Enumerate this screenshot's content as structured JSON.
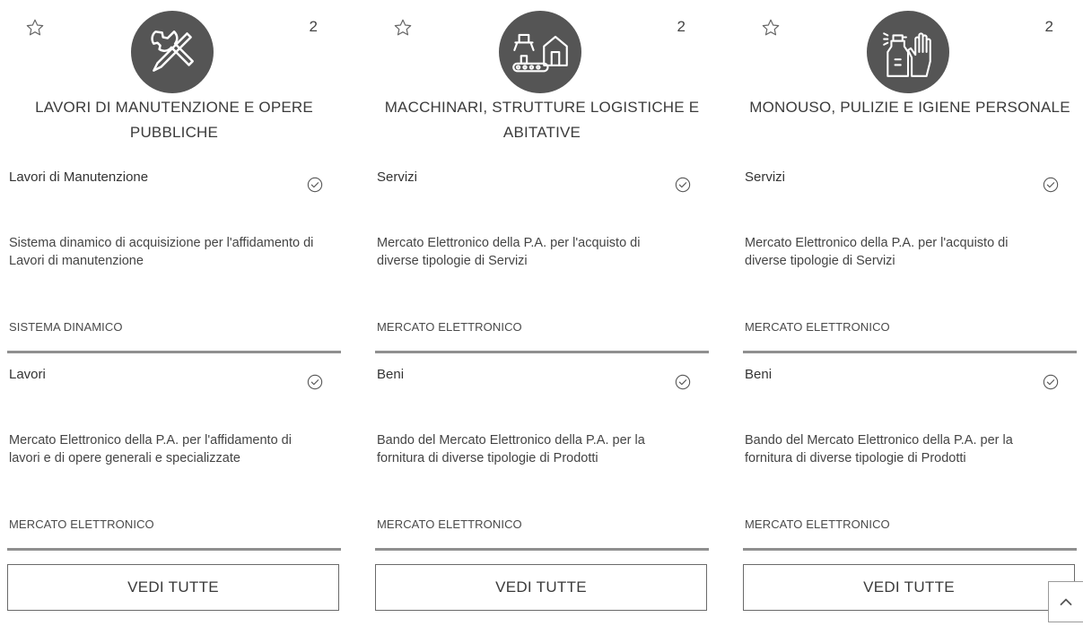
{
  "cards": [
    {
      "title": "LAVORI DI MANUTENZIONE E OPERE PUBBLICHE",
      "count": "2",
      "icon": "tools-icon",
      "items": [
        {
          "name": "Lavori di Manutenzione",
          "description": "Sistema dinamico di acquisizione per l'affidamento di Lavori di manutenzione",
          "type": "SISTEMA DINAMICO"
        },
        {
          "name": "Lavori",
          "description": "Mercato Elettronico della P.A. per l'affidamento di lavori e di opere generali e specializzate",
          "type": "MERCATO ELETTRONICO"
        }
      ],
      "button": "VEDI TUTTE"
    },
    {
      "title": "MACCHINARI, STRUTTURE LOGISTICHE E ABITATIVE",
      "count": "2",
      "icon": "machinery-house-icon",
      "items": [
        {
          "name": "Servizi",
          "description": "Mercato Elettronico della P.A. per l'acquisto di diverse tipologie di Servizi",
          "type": "MERCATO ELETTRONICO"
        },
        {
          "name": "Beni",
          "description": "Bando del Mercato Elettronico della P.A. per la fornitura di diverse tipologie di Prodotti",
          "type": "MERCATO ELETTRONICO"
        }
      ],
      "button": "VEDI TUTTE"
    },
    {
      "title": "MONOUSO, PULIZIE E IGIENE PERSONALE",
      "count": "2",
      "icon": "cleaning-spray-glove-icon",
      "items": [
        {
          "name": "Servizi",
          "description": "Mercato Elettronico della P.A. per l'acquisto di diverse tipologie di Servizi",
          "type": "MERCATO ELETTRONICO"
        },
        {
          "name": "Beni",
          "description": "Bando del Mercato Elettronico della P.A. per la fornitura di diverse tipologie di Prodotti",
          "type": "MERCATO ELETTRONICO"
        }
      ],
      "button": "VEDI TUTTE"
    }
  ],
  "colors": {
    "badge": "#555555",
    "rule": "#8f8f8f",
    "border": "#6a6a6a"
  },
  "scroll_top_icon": "chevron-up-icon"
}
